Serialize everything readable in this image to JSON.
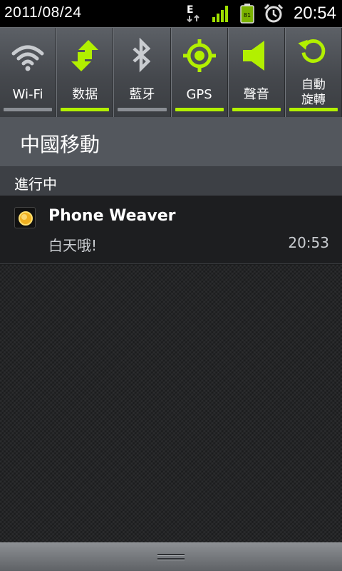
{
  "status_bar": {
    "date": "2011/08/24",
    "time": "20:54",
    "network_type": "E",
    "battery_level": "81",
    "icons": [
      "edge-data-icon",
      "signal-strength-icon",
      "battery-icon",
      "alarm-clock-icon"
    ]
  },
  "toggles": [
    {
      "name": "wifi",
      "label": "Wi-Fi",
      "icon": "wifi-icon",
      "active": false
    },
    {
      "name": "data",
      "label": "数据",
      "icon": "data-arrows-icon",
      "active": true
    },
    {
      "name": "bluetooth",
      "label": "藍牙",
      "icon": "bluetooth-icon",
      "active": false
    },
    {
      "name": "gps",
      "label": "GPS",
      "icon": "gps-icon",
      "active": true
    },
    {
      "name": "sound",
      "label": "聲音",
      "icon": "speaker-icon",
      "active": true
    },
    {
      "name": "rotation",
      "label_line1": "自動",
      "label_line2": "旋轉",
      "icon": "rotate-icon",
      "active": true
    }
  ],
  "carrier": {
    "label": "中國移動"
  },
  "ongoing": {
    "header": "進行中"
  },
  "notification": {
    "app": "Phone Weaver",
    "message": "白天哦!",
    "time": "20:53",
    "icon": "sun-icon"
  },
  "colors": {
    "active_green": "#b2f000",
    "inactive_gray": "#8a8e94",
    "background": "#1c1d1e"
  }
}
